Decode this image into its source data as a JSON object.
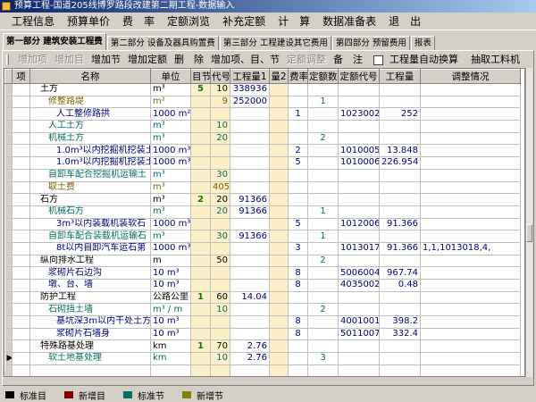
{
  "window": {
    "title": "预算工程-国道205线博罗路段改建第二期工程-数据输入"
  },
  "menu": [
    "工程信息",
    "预算单价",
    "费　率",
    "定额浏览",
    "补充定额",
    "计　算",
    "数据准备表",
    "退　出"
  ],
  "tabs": [
    {
      "label": "第一部分 建筑安装工程费",
      "active": true
    },
    {
      "label": "第二部分 设备及器具购置费",
      "active": false
    },
    {
      "label": "第三部分 工程建设其它费用",
      "active": false
    },
    {
      "label": "第四部分 预留费用",
      "active": false
    },
    {
      "label": "报表",
      "active": false
    }
  ],
  "toolbar": {
    "buttons": [
      {
        "label": "增加项",
        "disabled": true
      },
      {
        "label": "增加目",
        "disabled": true
      },
      {
        "label": "增加节",
        "disabled": false
      },
      {
        "label": "增加定额",
        "disabled": false
      },
      {
        "label": "删　除",
        "disabled": false
      },
      {
        "label": "增加项、目、节",
        "disabled": false
      },
      {
        "label": "定额调整",
        "disabled": true
      },
      {
        "label": "备　注",
        "disabled": false
      }
    ],
    "auto_convert_label": "工程量自动换算",
    "extract_label": "抽取工料机"
  },
  "columns": [
    "项",
    "名称",
    "单位",
    "目节",
    "代号",
    "工程量1",
    "量2",
    "费率",
    "定额数",
    "定额代号",
    "工程量",
    "调整情况"
  ],
  "rows": [
    {
      "indicator": "",
      "name": "土方",
      "name_indent": 1,
      "color": "black",
      "unit": "m³",
      "mujie": "5",
      "code": "10",
      "qty1": "338936",
      "q2": "",
      "rate": "",
      "dcount": "",
      "dcode": "",
      "qty": "",
      "adjust": ""
    },
    {
      "indicator": "",
      "name": "修整路堤",
      "name_indent": 2,
      "color": "olive",
      "unit": "m²",
      "mujie": "",
      "code": "9",
      "qty1": "252000",
      "q2": "",
      "rate": "",
      "dcount": "1",
      "dcode": "",
      "qty": "",
      "adjust": ""
    },
    {
      "indicator": "",
      "name": "人工整修路拱",
      "name_indent": 3,
      "color": "navy",
      "unit": "1000 m²",
      "mujie": "",
      "code": "",
      "qty1": "",
      "q2": "",
      "rate": "1",
      "dcount": "",
      "dcode": "1023002",
      "qty": "252",
      "adjust": ""
    },
    {
      "indicator": "",
      "name": "人工土方",
      "name_indent": 2,
      "color": "teal",
      "unit": "m³",
      "mujie": "",
      "code": "10",
      "qty1": "",
      "q2": "",
      "rate": "",
      "dcount": "",
      "dcode": "",
      "qty": "",
      "adjust": ""
    },
    {
      "indicator": "",
      "name": "机械土方",
      "name_indent": 2,
      "color": "teal",
      "unit": "m³",
      "mujie": "",
      "code": "20",
      "qty1": "",
      "q2": "",
      "rate": "",
      "dcount": "2",
      "dcode": "",
      "qty": "",
      "adjust": ""
    },
    {
      "indicator": "",
      "name": "1.0m³以内挖掘机挖装土",
      "name_indent": 3,
      "color": "navy",
      "unit": "1000 m³",
      "mujie": "",
      "code": "",
      "qty1": "",
      "q2": "",
      "rate": "2",
      "dcount": "",
      "dcode": "1010005",
      "qty": "13.848",
      "adjust": ""
    },
    {
      "indicator": "",
      "name": "1.0m³以内挖掘机挖装土",
      "name_indent": 3,
      "color": "navy",
      "unit": "1000 m³",
      "mujie": "",
      "code": "",
      "qty1": "",
      "q2": "",
      "rate": "5",
      "dcount": "",
      "dcode": "1010006",
      "qty": "226.954",
      "adjust": ""
    },
    {
      "indicator": "",
      "name": "自卸车配合挖掘机运输土",
      "name_indent": 2,
      "color": "teal",
      "unit": "m³",
      "mujie": "",
      "code": "30",
      "qty1": "",
      "q2": "",
      "rate": "",
      "dcount": "",
      "dcode": "",
      "qty": "",
      "adjust": ""
    },
    {
      "indicator": "",
      "name": "取土费",
      "name_indent": 2,
      "color": "olive",
      "unit": "m³",
      "mujie": "",
      "code": "405",
      "qty1": "",
      "q2": "",
      "rate": "",
      "dcount": "",
      "dcode": "",
      "qty": "",
      "adjust": ""
    },
    {
      "indicator": "",
      "name": "石方",
      "name_indent": 1,
      "color": "black",
      "unit": "m³",
      "mujie": "2",
      "code": "20",
      "qty1": "91366",
      "q2": "",
      "rate": "",
      "dcount": "",
      "dcode": "",
      "qty": "",
      "adjust": ""
    },
    {
      "indicator": "",
      "name": "机械石方",
      "name_indent": 2,
      "color": "teal",
      "unit": "m³",
      "mujie": "",
      "code": "20",
      "qty1": "91366",
      "q2": "",
      "rate": "",
      "dcount": "1",
      "dcode": "",
      "qty": "",
      "adjust": ""
    },
    {
      "indicator": "",
      "name": "3m³以内装载机装软石",
      "name_indent": 3,
      "color": "navy",
      "unit": "1000 m³",
      "mujie": "",
      "code": "",
      "qty1": "",
      "q2": "",
      "rate": "5",
      "dcount": "",
      "dcode": "1012006",
      "qty": "91.366",
      "adjust": ""
    },
    {
      "indicator": "",
      "name": "自卸车配合装载机运输石",
      "name_indent": 2,
      "color": "teal",
      "unit": "m³",
      "mujie": "",
      "code": "30",
      "qty1": "91366",
      "q2": "",
      "rate": "",
      "dcount": "1",
      "dcode": "",
      "qty": "",
      "adjust": ""
    },
    {
      "indicator": "",
      "name": "8t以内自卸汽车运石第",
      "name_indent": 3,
      "color": "navy",
      "unit": "1000 m³",
      "mujie": "",
      "code": "",
      "qty1": "",
      "q2": "",
      "rate": "3",
      "dcount": "",
      "dcode": "1013017",
      "qty": "91.366",
      "adjust": "1,1,1013018,4,"
    },
    {
      "indicator": "",
      "name": "纵向排水工程",
      "name_indent": 1,
      "color": "black",
      "unit": "m",
      "mujie": "",
      "code": "50",
      "qty1": "",
      "q2": "",
      "rate": "",
      "dcount": "2",
      "dcode": "",
      "qty": "",
      "adjust": ""
    },
    {
      "indicator": "",
      "name": "浆砌片石边沟",
      "name_indent": 2,
      "color": "navy",
      "unit": "10 m³",
      "mujie": "",
      "code": "",
      "qty1": "",
      "q2": "",
      "rate": "8",
      "dcount": "",
      "dcode": "5006004",
      "qty": "967.74",
      "adjust": ""
    },
    {
      "indicator": "",
      "name": "墩、台、墙",
      "name_indent": 2,
      "color": "navy",
      "unit": "10 m³",
      "mujie": "",
      "code": "",
      "qty1": "",
      "q2": "",
      "rate": "8",
      "dcount": "",
      "dcode": "4035002",
      "qty": "0.48",
      "adjust": ""
    },
    {
      "indicator": "",
      "name": "防护工程",
      "name_indent": 1,
      "color": "black",
      "unit": "公路公里",
      "mujie": "1",
      "code": "60",
      "qty1": "14.04",
      "q2": "",
      "rate": "",
      "dcount": "",
      "dcode": "",
      "qty": "",
      "adjust": ""
    },
    {
      "indicator": "",
      "name": "石砌挡土墙",
      "name_indent": 2,
      "color": "teal",
      "unit": "m³ / m",
      "mujie": "",
      "code": "10",
      "qty1": "",
      "q2": "",
      "rate": "",
      "dcount": "2",
      "dcode": "",
      "qty": "",
      "adjust": ""
    },
    {
      "indicator": "",
      "name": "基坑深3m以内干处土方",
      "name_indent": 3,
      "color": "navy",
      "unit": "10 m³",
      "mujie": "",
      "code": "",
      "qty1": "",
      "q2": "",
      "rate": "8",
      "dcount": "",
      "dcode": "4001001",
      "qty": "398.2",
      "adjust": ""
    },
    {
      "indicator": "",
      "name": "浆砌片石墙身",
      "name_indent": 3,
      "color": "navy",
      "unit": "10 m³",
      "mujie": "",
      "code": "",
      "qty1": "",
      "q2": "",
      "rate": "8",
      "dcount": "",
      "dcode": "5011007",
      "qty": "332.4",
      "adjust": ""
    },
    {
      "indicator": "",
      "name": "特殊路基处理",
      "name_indent": 1,
      "color": "black",
      "unit": "km",
      "mujie": "1",
      "code": "70",
      "qty1": "2.76",
      "q2": "",
      "rate": "",
      "dcount": "",
      "dcode": "",
      "qty": "",
      "adjust": ""
    },
    {
      "indicator": "▶",
      "name": "软土地基处理",
      "name_indent": 2,
      "color": "teal",
      "unit": "km",
      "mujie": "",
      "code": "10",
      "qty1": "2.76",
      "q2": "",
      "rate": "",
      "dcount": "3",
      "dcode": "",
      "qty": "",
      "adjust": ""
    },
    {
      "indicator": "",
      "name": "",
      "name_indent": 0,
      "color": "black",
      "unit": "",
      "mujie": "",
      "code": "",
      "qty1": "",
      "q2": "",
      "rate": "",
      "dcount": "",
      "dcode": "",
      "qty": "",
      "adjust": ""
    }
  ],
  "legend": [
    {
      "label": "标准目",
      "color": "#000000"
    },
    {
      "label": "新增目",
      "color": "#800000"
    },
    {
      "label": "标准节",
      "color": "#007060"
    },
    {
      "label": "新增节",
      "color": "#808000"
    }
  ]
}
